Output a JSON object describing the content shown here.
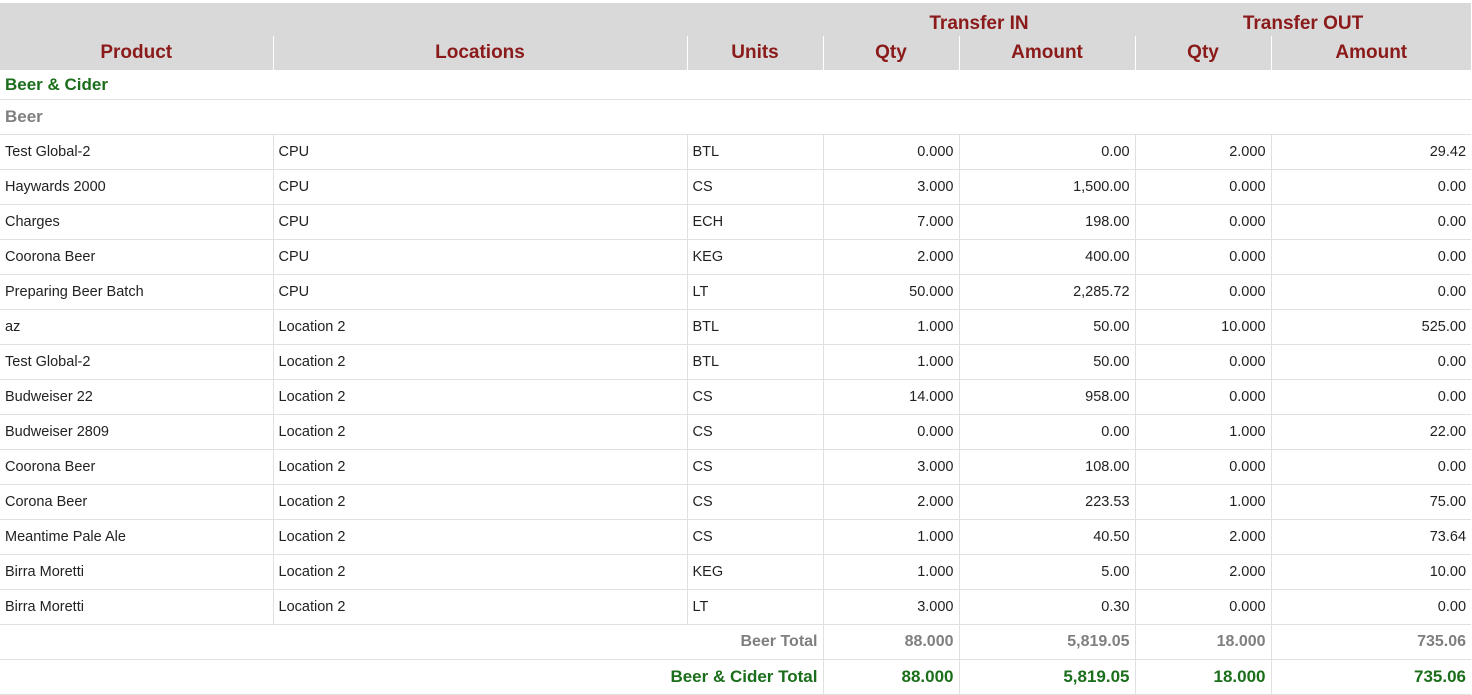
{
  "header": {
    "group_in": "Transfer IN",
    "group_out": "Transfer OUT",
    "product": "Product",
    "locations": "Locations",
    "units": "Units",
    "in_qty": "Qty",
    "in_amount": "Amount",
    "out_qty": "Qty",
    "out_amount": "Amount"
  },
  "category": "Beer & Cider",
  "subcategory": "Beer",
  "rows": [
    {
      "product": "Test Global-2",
      "location": "CPU",
      "unit": "BTL",
      "in_qty": "0.000",
      "in_amount": "0.00",
      "out_qty": "2.000",
      "out_amount": "29.42"
    },
    {
      "product": "Haywards 2000",
      "location": "CPU",
      "unit": "CS",
      "in_qty": "3.000",
      "in_amount": "1,500.00",
      "out_qty": "0.000",
      "out_amount": "0.00"
    },
    {
      "product": "Charges",
      "location": "CPU",
      "unit": "ECH",
      "in_qty": "7.000",
      "in_amount": "198.00",
      "out_qty": "0.000",
      "out_amount": "0.00"
    },
    {
      "product": "Coorona Beer",
      "location": "CPU",
      "unit": "KEG",
      "in_qty": "2.000",
      "in_amount": "400.00",
      "out_qty": "0.000",
      "out_amount": "0.00"
    },
    {
      "product": "Preparing Beer Batch",
      "location": "CPU",
      "unit": "LT",
      "in_qty": "50.000",
      "in_amount": "2,285.72",
      "out_qty": "0.000",
      "out_amount": "0.00"
    },
    {
      "product": "az",
      "location": "Location 2",
      "unit": "BTL",
      "in_qty": "1.000",
      "in_amount": "50.00",
      "out_qty": "10.000",
      "out_amount": "525.00"
    },
    {
      "product": "Test Global-2",
      "location": "Location 2",
      "unit": "BTL",
      "in_qty": "1.000",
      "in_amount": "50.00",
      "out_qty": "0.000",
      "out_amount": "0.00"
    },
    {
      "product": "Budweiser 22",
      "location": "Location 2",
      "unit": "CS",
      "in_qty": "14.000",
      "in_amount": "958.00",
      "out_qty": "0.000",
      "out_amount": "0.00"
    },
    {
      "product": "Budweiser 2809",
      "location": "Location 2",
      "unit": "CS",
      "in_qty": "0.000",
      "in_amount": "0.00",
      "out_qty": "1.000",
      "out_amount": "22.00"
    },
    {
      "product": "Coorona Beer",
      "location": "Location 2",
      "unit": "CS",
      "in_qty": "3.000",
      "in_amount": "108.00",
      "out_qty": "0.000",
      "out_amount": "0.00"
    },
    {
      "product": "Corona Beer",
      "location": "Location 2",
      "unit": "CS",
      "in_qty": "2.000",
      "in_amount": "223.53",
      "out_qty": "1.000",
      "out_amount": "75.00"
    },
    {
      "product": "Meantime Pale Ale",
      "location": "Location 2",
      "unit": "CS",
      "in_qty": "1.000",
      "in_amount": "40.50",
      "out_qty": "2.000",
      "out_amount": "73.64"
    },
    {
      "product": "Birra Moretti",
      "location": "Location 2",
      "unit": "KEG",
      "in_qty": "1.000",
      "in_amount": "5.00",
      "out_qty": "2.000",
      "out_amount": "10.00"
    },
    {
      "product": "Birra Moretti",
      "location": "Location 2",
      "unit": "LT",
      "in_qty": "3.000",
      "in_amount": "0.30",
      "out_qty": "0.000",
      "out_amount": "0.00"
    }
  ],
  "subtotal": {
    "label": "Beer Total",
    "in_qty": "88.000",
    "in_amount": "5,819.05",
    "out_qty": "18.000",
    "out_amount": "735.06"
  },
  "total": {
    "label": "Beer & Cider Total",
    "in_qty": "88.000",
    "in_amount": "5,819.05",
    "out_qty": "18.000",
    "out_amount": "735.06"
  },
  "colors": {
    "header_bg": "#d9d9d9",
    "header_text": "#8b1a1a",
    "category_text": "#1b6e1b",
    "subcategory_text": "#7f7f7f"
  }
}
